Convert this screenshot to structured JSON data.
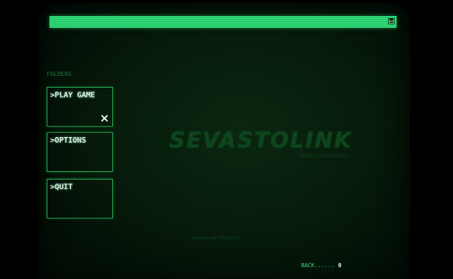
{
  "folders_label": "FOLDERS",
  "menu": [
    {
      "label": ">PLAY GAME"
    },
    {
      "label": ">OPTIONS"
    },
    {
      "label": ">QUIT"
    }
  ],
  "logo": {
    "title": "SEVASTOLINK",
    "subtitle": "ANLIM-LINK PRODUCT"
  },
  "footer_product": "ANLIM-LINK PRODUCT",
  "back": {
    "label": "BACK......",
    "key": "0"
  },
  "icons": {
    "topbar": "save-disk-icon",
    "close": "close-icon"
  },
  "colors": {
    "accent": "#2ee07a",
    "text": "#e8fff0",
    "background": "#071d0c"
  }
}
